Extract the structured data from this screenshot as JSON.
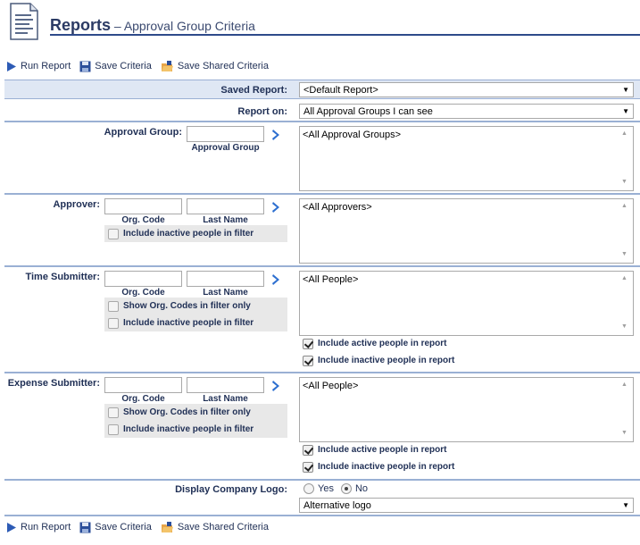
{
  "header": {
    "title_bold": "Reports",
    "title_sep": " – ",
    "title_sub": "Approval Group Criteria"
  },
  "toolbar": {
    "run": "Run Report",
    "save": "Save Criteria",
    "save_shared": "Save Shared Criteria"
  },
  "saved_report": {
    "label": "Saved Report:",
    "value": "<Default Report>"
  },
  "report_on": {
    "label": "Report on:",
    "value": "All Approval Groups I can see"
  },
  "approval_group": {
    "label": "Approval Group:",
    "field_caption": "Approval Group",
    "list_value": "<All Approval Groups>"
  },
  "approver": {
    "label": "Approver:",
    "org_caption": "Org. Code",
    "last_caption": "Last Name",
    "opt_inactive": "Include inactive people in filter",
    "list_value": "<All Approvers>"
  },
  "time_submitter": {
    "label": "Time Submitter:",
    "org_caption": "Org. Code",
    "last_caption": "Last Name",
    "opt_show_org": "Show Org. Codes in filter only",
    "opt_inactive": "Include inactive people in filter",
    "list_value": "<All People>",
    "inc_active": "Include active people in report",
    "inc_inactive": "Include inactive people in report"
  },
  "expense_submitter": {
    "label": "Expense Submitter:",
    "org_caption": "Org. Code",
    "last_caption": "Last Name",
    "opt_show_org": "Show Org. Codes in filter only",
    "opt_inactive": "Include inactive people in filter",
    "list_value": "<All People>",
    "inc_active": "Include active people in report",
    "inc_inactive": "Include inactive people in report"
  },
  "logo": {
    "label": "Display Company Logo:",
    "yes": "Yes",
    "no": "No",
    "selected": "No",
    "select_value": "Alternative logo"
  },
  "colors": {
    "accent": "#2e4a8a",
    "label": "#1f2f55",
    "saved_row_bg": "#dfe7f4",
    "option_panel": "#e8e8e8"
  }
}
